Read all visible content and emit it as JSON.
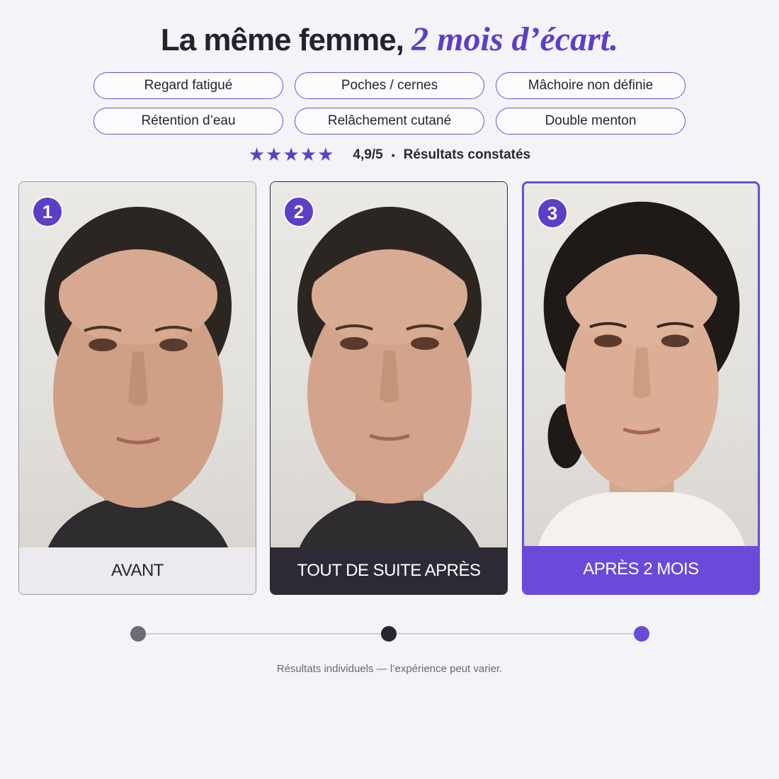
{
  "headline": {
    "main": "La même femme,",
    "accent": "2 mois d’écart."
  },
  "concerns": [
    "Regard fatigué",
    "Poches / cernes",
    "Mâchoire non définie",
    "Rétention d’eau",
    "Relâchement cutané",
    "Double menton"
  ],
  "rating": {
    "stars": "★★★★★",
    "score": "4,9/5",
    "separator": "•",
    "text": "Résultats constatés"
  },
  "cards": [
    {
      "number": "1",
      "label": "AVANT"
    },
    {
      "number": "2",
      "label": "TOUT DE SUITE APRÈS"
    },
    {
      "number": "3",
      "label": "APRÈS 2 MOIS"
    }
  ],
  "colors": {
    "accent": "#5b3fc7",
    "dark": "#2d2935",
    "light": "#eceaef",
    "background": "#f4f3f8"
  },
  "disclaimer": "Résultats individuels — l’expérience peut varier."
}
